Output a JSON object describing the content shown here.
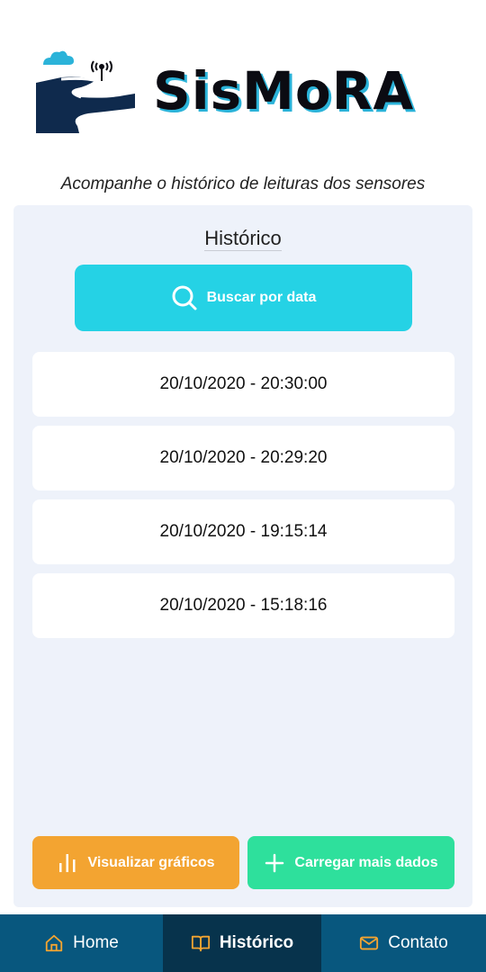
{
  "header": {
    "logo_text": "SisMoRA"
  },
  "subtitle": "Acompanhe o histórico de leituras dos sensores",
  "panel": {
    "title": "Histórico",
    "search_label": "Buscar por data",
    "records": [
      "20/10/2020 - 20:30:00",
      "20/10/2020 - 20:29:20",
      "20/10/2020 - 19:15:14",
      "20/10/2020 - 15:18:16"
    ],
    "charts_label": "Visualizar gráficos",
    "load_more_label": "Carregar mais dados"
  },
  "nav": {
    "home": "Home",
    "history": "Histórico",
    "contact": "Contato",
    "active": "history"
  },
  "colors": {
    "search_button": "#25d2e5",
    "charts_button": "#f3a431",
    "load_more_button": "#2ee09c",
    "nav_background": "#08577e",
    "nav_active": "#07334c",
    "icon_accent": "#f3a431"
  },
  "icons": {
    "search": "search-icon",
    "charts": "bar-chart-icon",
    "load_more": "plus-icon",
    "home": "home-icon",
    "history": "book-icon",
    "contact": "mail-icon"
  }
}
